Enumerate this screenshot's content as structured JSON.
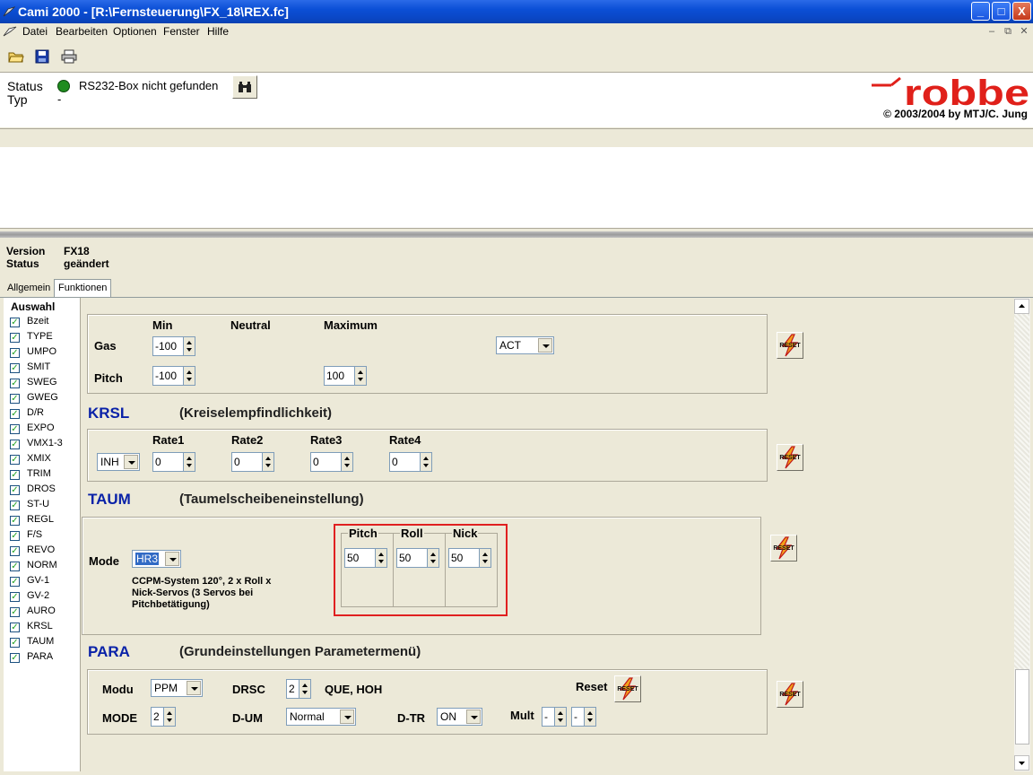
{
  "window": {
    "title": "Cami 2000 - [R:\\Fernsteuerung\\FX_18\\REX.fc]",
    "minimize": "_",
    "maximize": "□",
    "close": "X"
  },
  "menu": {
    "items": [
      "Datei",
      "Bearbeiten",
      "Optionen",
      "Fenster",
      "Hilfe"
    ]
  },
  "toolbar": {
    "icons": [
      "open-folder-icon",
      "save-icon",
      "print-icon"
    ]
  },
  "status": {
    "status_label": "Status",
    "status_text": "RS232-Box nicht gefunden",
    "status_color": "#1f8c1f",
    "typ_label": "Typ",
    "typ_value": "-",
    "copyright": "© 2003/2004 by MTJ/C. Jung",
    "logo_text": "robbe",
    "logo_color": "#e0201a"
  },
  "version": {
    "version_label": "Version",
    "version_value": "FX18",
    "status_label": "Status",
    "status_value": "geändert"
  },
  "tabs": [
    "Allgemein",
    "Funktionen"
  ],
  "auswahl": {
    "title": "Auswahl",
    "items": [
      "Bzeit",
      "TYPE",
      "UMPO",
      "SMIT",
      "SWEG",
      "GWEG",
      "D/R",
      "EXPO",
      "VMX1-3",
      "XMIX",
      "TRIM",
      "DROS",
      "ST-U",
      "REGL",
      "F/S",
      "REVO",
      "NORM",
      "GV-1",
      "GV-2",
      "AURO",
      "KRSL",
      "TAUM",
      "PARA"
    ]
  },
  "gas_section": {
    "min_label": "Min",
    "neutral_label": "Neutral",
    "max_label": "Maximum",
    "gas_label": "Gas",
    "gas_min": "-100",
    "gas_combo": "ACT",
    "pitch_label": "Pitch",
    "pitch_min": "-100",
    "pitch_max": "100"
  },
  "krsl": {
    "title": "KRSL",
    "subtitle": "(Kreiselempfindlichkeit)",
    "combo": "INH",
    "rate_labels": [
      "Rate1",
      "Rate2",
      "Rate3",
      "Rate4"
    ],
    "rate_values": [
      "0",
      "0",
      "0",
      "0"
    ]
  },
  "taum": {
    "title": "TAUM",
    "subtitle": "(Taumelscheibeneinstellung)",
    "mode_label": "Mode",
    "mode_value": "HR3",
    "description": "CCPM-System 120°, 2 x Roll x Nick-Servos (3 Servos bei Pitchbetätigung)",
    "col_labels": [
      "Pitch",
      "Roll",
      "Nick"
    ],
    "col_values": [
      "50",
      "50",
      "50"
    ]
  },
  "para": {
    "title": "PARA",
    "subtitle": "(Grundeinstellungen Parametermenü)",
    "modu_label": "Modu",
    "modu_value": "PPM",
    "drsc_label": "DRSC",
    "drsc_value": "2",
    "drsc_text": "QUE, HOH",
    "reset_label": "Reset",
    "mode_label": "MODE",
    "mode_value": "2",
    "dum_label": "D-UM",
    "dum_value": "Normal",
    "dtr_label": "D-TR",
    "dtr_value": "ON",
    "mult_label": "Mult",
    "mult_value1": "-",
    "mult_value2": "-"
  },
  "reset_icon_text": "RESET"
}
